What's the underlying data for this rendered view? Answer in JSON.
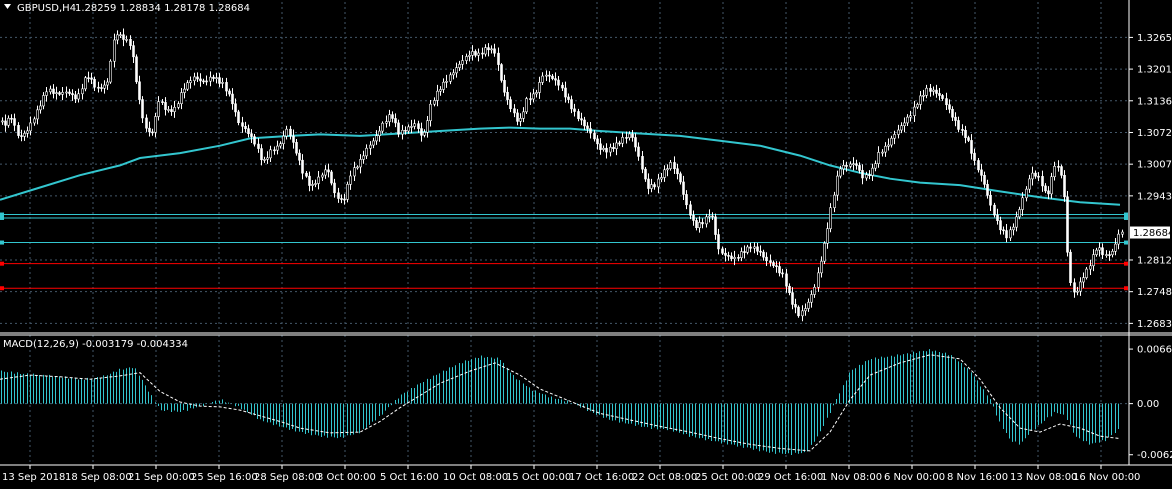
{
  "header": {
    "title": "GBPUSD,H4",
    "quote": "1.28259 1.28834 1.28178 1.28684"
  },
  "colors": {
    "background": "#000000",
    "grid": "#44586a",
    "axis": "#ffffff",
    "candle": "#ffffff",
    "candle_up_fill": "#000000",
    "ma": "#33c6cf",
    "macd_hist": "#33c6cf",
    "macd_signal": "#ffffff",
    "level_cyan": "#33c6cf",
    "level_red": "#ff0000",
    "price_tag_bg": "#ffffff",
    "price_tag_text": "#000000"
  },
  "chart_data": [
    {
      "type": "candlestick",
      "name": "price",
      "ylim": [
        1.267,
        1.3305
      ],
      "yticks": [
        "1.32655",
        "1.32010",
        "1.31365",
        "1.30720",
        "1.30075",
        "1.29430",
        "1.28125",
        "1.27480",
        "1.26835"
      ],
      "current_price": "1.28684",
      "xticks": [
        "13 Sep 2018",
        "18 Sep 08:00",
        "21 Sep 00:00",
        "25 Sep 16:00",
        "28 Sep 08:00",
        "3 Oct 00:00",
        "5 Oct 16:00",
        "10 Oct 08:00",
        "15 Oct 00:00",
        "17 Oct 16:00",
        "22 Oct 08:00",
        "25 Oct 00:00",
        "29 Oct 16:00",
        "1 Nov 08:00",
        "6 Nov 00:00",
        "8 Nov 16:00",
        "13 Nov 08:00",
        "16 Nov 00:00"
      ],
      "price_path": [
        [
          0,
          1.3095
        ],
        [
          8,
          1.309
        ],
        [
          14,
          1.3105
        ],
        [
          22,
          1.306
        ],
        [
          30,
          1.3075
        ],
        [
          40,
          1.3115
        ],
        [
          50,
          1.316
        ],
        [
          60,
          1.315
        ],
        [
          70,
          1.3155
        ],
        [
          80,
          1.314
        ],
        [
          90,
          1.319
        ],
        [
          100,
          1.316
        ],
        [
          110,
          1.317
        ],
        [
          118,
          1.3275
        ],
        [
          126,
          1.3265
        ],
        [
          134,
          1.325
        ],
        [
          142,
          1.314
        ],
        [
          148,
          1.308
        ],
        [
          155,
          1.307
        ],
        [
          162,
          1.314
        ],
        [
          170,
          1.3115
        ],
        [
          178,
          1.312
        ],
        [
          186,
          1.316
        ],
        [
          196,
          1.3185
        ],
        [
          206,
          1.3175
        ],
        [
          216,
          1.3185
        ],
        [
          226,
          1.317
        ],
        [
          234,
          1.314
        ],
        [
          242,
          1.309
        ],
        [
          250,
          1.3075
        ],
        [
          258,
          1.305
        ],
        [
          266,
          1.301
        ],
        [
          274,
          1.3035
        ],
        [
          282,
          1.3045
        ],
        [
          290,
          1.308
        ],
        [
          298,
          1.304
        ],
        [
          306,
          1.299
        ],
        [
          314,
          1.296
        ],
        [
          322,
          1.298
        ],
        [
          330,
          1.3
        ],
        [
          338,
          1.2945
        ],
        [
          346,
          1.293
        ],
        [
          354,
          1.299
        ],
        [
          362,
          1.301
        ],
        [
          370,
          1.304
        ],
        [
          378,
          1.306
        ],
        [
          386,
          1.309
        ],
        [
          394,
          1.311
        ],
        [
          402,
          1.307
        ],
        [
          410,
          1.308
        ],
        [
          418,
          1.309
        ],
        [
          426,
          1.306
        ],
        [
          434,
          1.313
        ],
        [
          442,
          1.316
        ],
        [
          450,
          1.318
        ],
        [
          458,
          1.32
        ],
        [
          466,
          1.322
        ],
        [
          474,
          1.3235
        ],
        [
          482,
          1.323
        ],
        [
          490,
          1.3245
        ],
        [
          498,
          1.3235
        ],
        [
          506,
          1.316
        ],
        [
          514,
          1.312
        ],
        [
          522,
          1.309
        ],
        [
          530,
          1.314
        ],
        [
          538,
          1.315
        ],
        [
          546,
          1.319
        ],
        [
          554,
          1.3185
        ],
        [
          562,
          1.317
        ],
        [
          570,
          1.314
        ],
        [
          578,
          1.311
        ],
        [
          586,
          1.309
        ],
        [
          594,
          1.307
        ],
        [
          602,
          1.304
        ],
        [
          610,
          1.3035
        ],
        [
          618,
          1.3045
        ],
        [
          626,
          1.306
        ],
        [
          634,
          1.307
        ],
        [
          642,
          1.302
        ],
        [
          650,
          1.296
        ],
        [
          658,
          1.2965
        ],
        [
          666,
          1.299
        ],
        [
          674,
          1.301
        ],
        [
          682,
          1.298
        ],
        [
          690,
          1.292
        ],
        [
          698,
          1.288
        ],
        [
          706,
          1.289
        ],
        [
          714,
          1.291
        ],
        [
          722,
          1.283
        ],
        [
          730,
          1.282
        ],
        [
          738,
          1.2815
        ],
        [
          746,
          1.283
        ],
        [
          754,
          1.284
        ],
        [
          762,
          1.283
        ],
        [
          770,
          1.281
        ],
        [
          778,
          1.28
        ],
        [
          786,
          1.278
        ],
        [
          794,
          1.273
        ],
        [
          802,
          1.27
        ],
        [
          810,
          1.272
        ],
        [
          818,
          1.276
        ],
        [
          826,
          1.283
        ],
        [
          834,
          1.292
        ],
        [
          842,
          1.3
        ],
        [
          850,
          1.3005
        ],
        [
          858,
          1.301
        ],
        [
          866,
          1.298
        ],
        [
          874,
          1.299
        ],
        [
          882,
          1.303
        ],
        [
          890,
          1.3045
        ],
        [
          898,
          1.307
        ],
        [
          906,
          1.309
        ],
        [
          914,
          1.311
        ],
        [
          922,
          1.314
        ],
        [
          930,
          1.316
        ],
        [
          938,
          1.3155
        ],
        [
          946,
          1.314
        ],
        [
          954,
          1.311
        ],
        [
          962,
          1.308
        ],
        [
          970,
          1.306
        ],
        [
          978,
          1.301
        ],
        [
          986,
          1.2975
        ],
        [
          994,
          1.292
        ],
        [
          1002,
          1.288
        ],
        [
          1010,
          1.286
        ],
        [
          1018,
          1.289
        ],
        [
          1026,
          1.294
        ],
        [
          1034,
          1.299
        ],
        [
          1042,
          1.298
        ],
        [
          1050,
          1.294
        ],
        [
          1058,
          1.301
        ],
        [
          1066,
          1.298
        ],
        [
          1072,
          1.2775
        ],
        [
          1078,
          1.274
        ],
        [
          1084,
          1.277
        ],
        [
          1092,
          1.28
        ],
        [
          1100,
          1.284
        ],
        [
          1108,
          1.282
        ],
        [
          1116,
          1.283
        ],
        [
          1122,
          1.2868
        ]
      ],
      "moving_average": [
        [
          0,
          1.2935
        ],
        [
          40,
          1.296
        ],
        [
          80,
          1.2985
        ],
        [
          120,
          1.3005
        ],
        [
          140,
          1.302
        ],
        [
          180,
          1.303
        ],
        [
          220,
          1.3045
        ],
        [
          250,
          1.306
        ],
        [
          290,
          1.3065
        ],
        [
          320,
          1.3068
        ],
        [
          360,
          1.3065
        ],
        [
          400,
          1.307
        ],
        [
          440,
          1.3075
        ],
        [
          480,
          1.308
        ],
        [
          510,
          1.3082
        ],
        [
          540,
          1.308
        ],
        [
          570,
          1.308
        ],
        [
          600,
          1.3075
        ],
        [
          640,
          1.307
        ],
        [
          680,
          1.3065
        ],
        [
          720,
          1.3055
        ],
        [
          760,
          1.3045
        ],
        [
          800,
          1.3025
        ],
        [
          830,
          1.3005
        ],
        [
          860,
          1.299
        ],
        [
          890,
          1.2978
        ],
        [
          920,
          1.297
        ],
        [
          960,
          1.2965
        ],
        [
          1000,
          1.2952
        ],
        [
          1040,
          1.294
        ],
        [
          1080,
          1.293
        ],
        [
          1120,
          1.2925
        ]
      ],
      "levels": [
        {
          "price": 1.2905,
          "color": "cyan"
        },
        {
          "price": 1.2898,
          "color": "cyan"
        },
        {
          "price": 1.2848,
          "color": "cyan"
        },
        {
          "price": 1.2805,
          "color": "red"
        },
        {
          "price": 1.2755,
          "color": "red"
        }
      ]
    },
    {
      "type": "bar",
      "name": "MACD",
      "title": "MACD(12,26,9) -0.003179 -0.004334",
      "ylim": [
        -0.0068,
        0.0072
      ],
      "yticks": [
        "0.006699",
        "0.00",
        "-0.006276"
      ],
      "histogram": [
        [
          0,
          0.004
        ],
        [
          20,
          0.0037
        ],
        [
          40,
          0.0035
        ],
        [
          60,
          0.0033
        ],
        [
          80,
          0.003
        ],
        [
          100,
          0.0032
        ],
        [
          120,
          0.0042
        ],
        [
          134,
          0.0045
        ],
        [
          146,
          0.002
        ],
        [
          160,
          -0.0008
        ],
        [
          180,
          -0.001
        ],
        [
          200,
          -0.0003
        ],
        [
          220,
          0.0005
        ],
        [
          240,
          -0.0005
        ],
        [
          260,
          -0.002
        ],
        [
          280,
          -0.0028
        ],
        [
          300,
          -0.0035
        ],
        [
          320,
          -0.004
        ],
        [
          340,
          -0.0042
        ],
        [
          360,
          -0.0035
        ],
        [
          380,
          -0.0015
        ],
        [
          400,
          0.001
        ],
        [
          420,
          0.0025
        ],
        [
          440,
          0.0038
        ],
        [
          460,
          0.005
        ],
        [
          480,
          0.0058
        ],
        [
          500,
          0.0055
        ],
        [
          512,
          0.0035
        ],
        [
          530,
          0.0018
        ],
        [
          550,
          0.0008
        ],
        [
          570,
          0.0002
        ],
        [
          590,
          -0.001
        ],
        [
          610,
          -0.002
        ],
        [
          630,
          -0.0025
        ],
        [
          650,
          -0.003
        ],
        [
          670,
          -0.0032
        ],
        [
          690,
          -0.004
        ],
        [
          710,
          -0.0045
        ],
        [
          730,
          -0.005
        ],
        [
          750,
          -0.0055
        ],
        [
          770,
          -0.006
        ],
        [
          790,
          -0.0062
        ],
        [
          806,
          -0.006
        ],
        [
          820,
          -0.0035
        ],
        [
          836,
          0.0005
        ],
        [
          850,
          0.004
        ],
        [
          870,
          0.0055
        ],
        [
          890,
          0.0058
        ],
        [
          910,
          0.0062
        ],
        [
          930,
          0.0066
        ],
        [
          950,
          0.006
        ],
        [
          970,
          0.004
        ],
        [
          990,
          0.0005
        ],
        [
          1000,
          -0.0025
        ],
        [
          1010,
          -0.0045
        ],
        [
          1020,
          -0.005
        ],
        [
          1030,
          -0.0035
        ],
        [
          1040,
          -0.0025
        ],
        [
          1055,
          -0.001
        ],
        [
          1065,
          -0.0015
        ],
        [
          1075,
          -0.004
        ],
        [
          1090,
          -0.005
        ],
        [
          1105,
          -0.0045
        ],
        [
          1120,
          -0.003
        ]
      ],
      "signal": [
        [
          0,
          0.003
        ],
        [
          30,
          0.0035
        ],
        [
          60,
          0.0033
        ],
        [
          90,
          0.003
        ],
        [
          120,
          0.0034
        ],
        [
          140,
          0.0038
        ],
        [
          160,
          0.0015
        ],
        [
          180,
          0.0002
        ],
        [
          200,
          -0.0003
        ],
        [
          220,
          -0.0004
        ],
        [
          240,
          -0.0008
        ],
        [
          260,
          -0.0015
        ],
        [
          280,
          -0.0022
        ],
        [
          300,
          -0.003
        ],
        [
          330,
          -0.0036
        ],
        [
          360,
          -0.0035
        ],
        [
          380,
          -0.0022
        ],
        [
          400,
          -0.0005
        ],
        [
          420,
          0.001
        ],
        [
          440,
          0.0025
        ],
        [
          470,
          0.004
        ],
        [
          495,
          0.005
        ],
        [
          520,
          0.0035
        ],
        [
          540,
          0.0018
        ],
        [
          560,
          0.0008
        ],
        [
          580,
          -0.0002
        ],
        [
          600,
          -0.0012
        ],
        [
          630,
          -0.002
        ],
        [
          660,
          -0.0028
        ],
        [
          690,
          -0.0035
        ],
        [
          720,
          -0.0043
        ],
        [
          750,
          -0.005
        ],
        [
          780,
          -0.0055
        ],
        [
          810,
          -0.0058
        ],
        [
          830,
          -0.0035
        ],
        [
          850,
          0.0005
        ],
        [
          870,
          0.0035
        ],
        [
          900,
          0.005
        ],
        [
          930,
          0.006
        ],
        [
          960,
          0.0055
        ],
        [
          980,
          0.003
        ],
        [
          1000,
          -0.0005
        ],
        [
          1020,
          -0.003
        ],
        [
          1040,
          -0.0035
        ],
        [
          1060,
          -0.0025
        ],
        [
          1080,
          -0.003
        ],
        [
          1100,
          -0.004
        ],
        [
          1120,
          -0.0043
        ]
      ]
    }
  ]
}
